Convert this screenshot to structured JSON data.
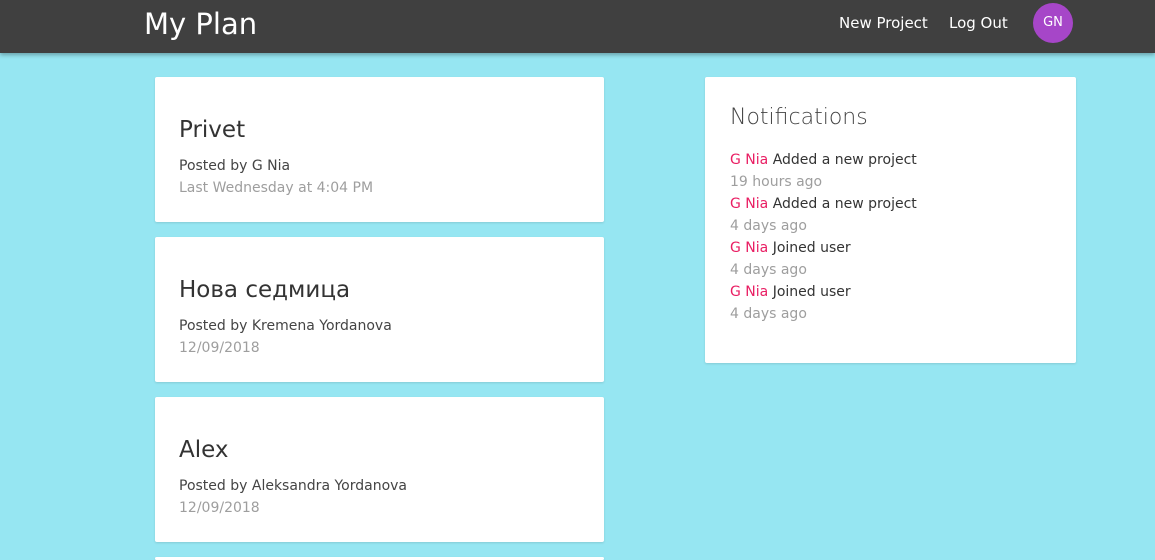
{
  "navbar": {
    "brand": "My Plan",
    "links": [
      "New Project",
      "Log Out"
    ],
    "avatar_initials": "GN",
    "colors": {
      "background": "#404040",
      "avatar": "#a646c8"
    }
  },
  "projects": [
    {
      "title": "Privet",
      "author": "Posted by G Nia",
      "date": "Last Wednesday at 4:04 PM"
    },
    {
      "title": "Нова седмица",
      "author": "Posted by Kremena Yordanova",
      "date": "12/09/2018"
    },
    {
      "title": "Alex",
      "author": "Posted by Aleksandra Yordanova",
      "date": "12/09/2018"
    }
  ],
  "notifications": {
    "title": "Notifications",
    "items": [
      {
        "user": "G Nia",
        "message": "Added a new project",
        "time": "19 hours ago"
      },
      {
        "user": "G Nia",
        "message": "Added a new project",
        "time": "4 days ago"
      },
      {
        "user": "G Nia",
        "message": "Joined user",
        "time": "4 days ago"
      },
      {
        "user": "G Nia",
        "message": "Joined user",
        "time": "4 days ago"
      }
    ]
  },
  "colors": {
    "page_background": "#96e6f2",
    "notification_user": "#e91e63",
    "muted_text": "#9e9e9e"
  }
}
